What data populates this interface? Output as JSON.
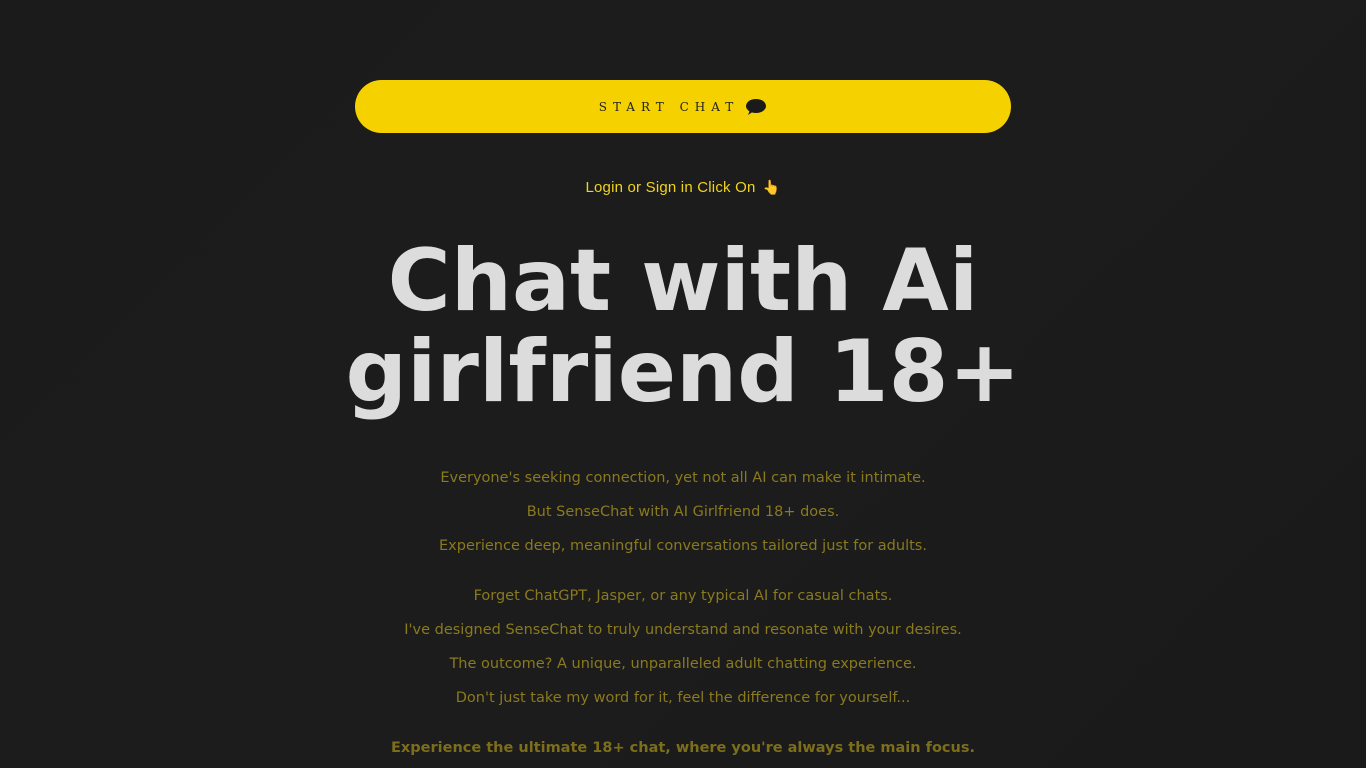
{
  "cta": {
    "start_label": "START CHAT",
    "chat_icon": "speech-bubble-icon",
    "accent": "#f5d100"
  },
  "login": {
    "text": "Login or Sign in Click On",
    "icon": "👆"
  },
  "headline": {
    "line1": "Chat with Ai",
    "line2": "girlfriend 18+"
  },
  "intro": {
    "lines": [
      "Everyone's seeking connection, yet not all AI can make it intimate.",
      "But SenseChat with AI Girlfriend 18+ does.",
      "Experience deep, meaningful conversations tailored just for adults."
    ]
  },
  "pitch": {
    "lines": [
      "Forget ChatGPT, Jasper, or any typical AI for casual chats.",
      "I've designed SenseChat to truly understand and resonate with your desires.",
      "The outcome? A unique, unparalleled adult chatting experience.",
      "Don't just take my word for it, feel the difference for yourself..."
    ]
  },
  "emphasis": "Experience the ultimate 18+ chat, where you're always the main focus."
}
